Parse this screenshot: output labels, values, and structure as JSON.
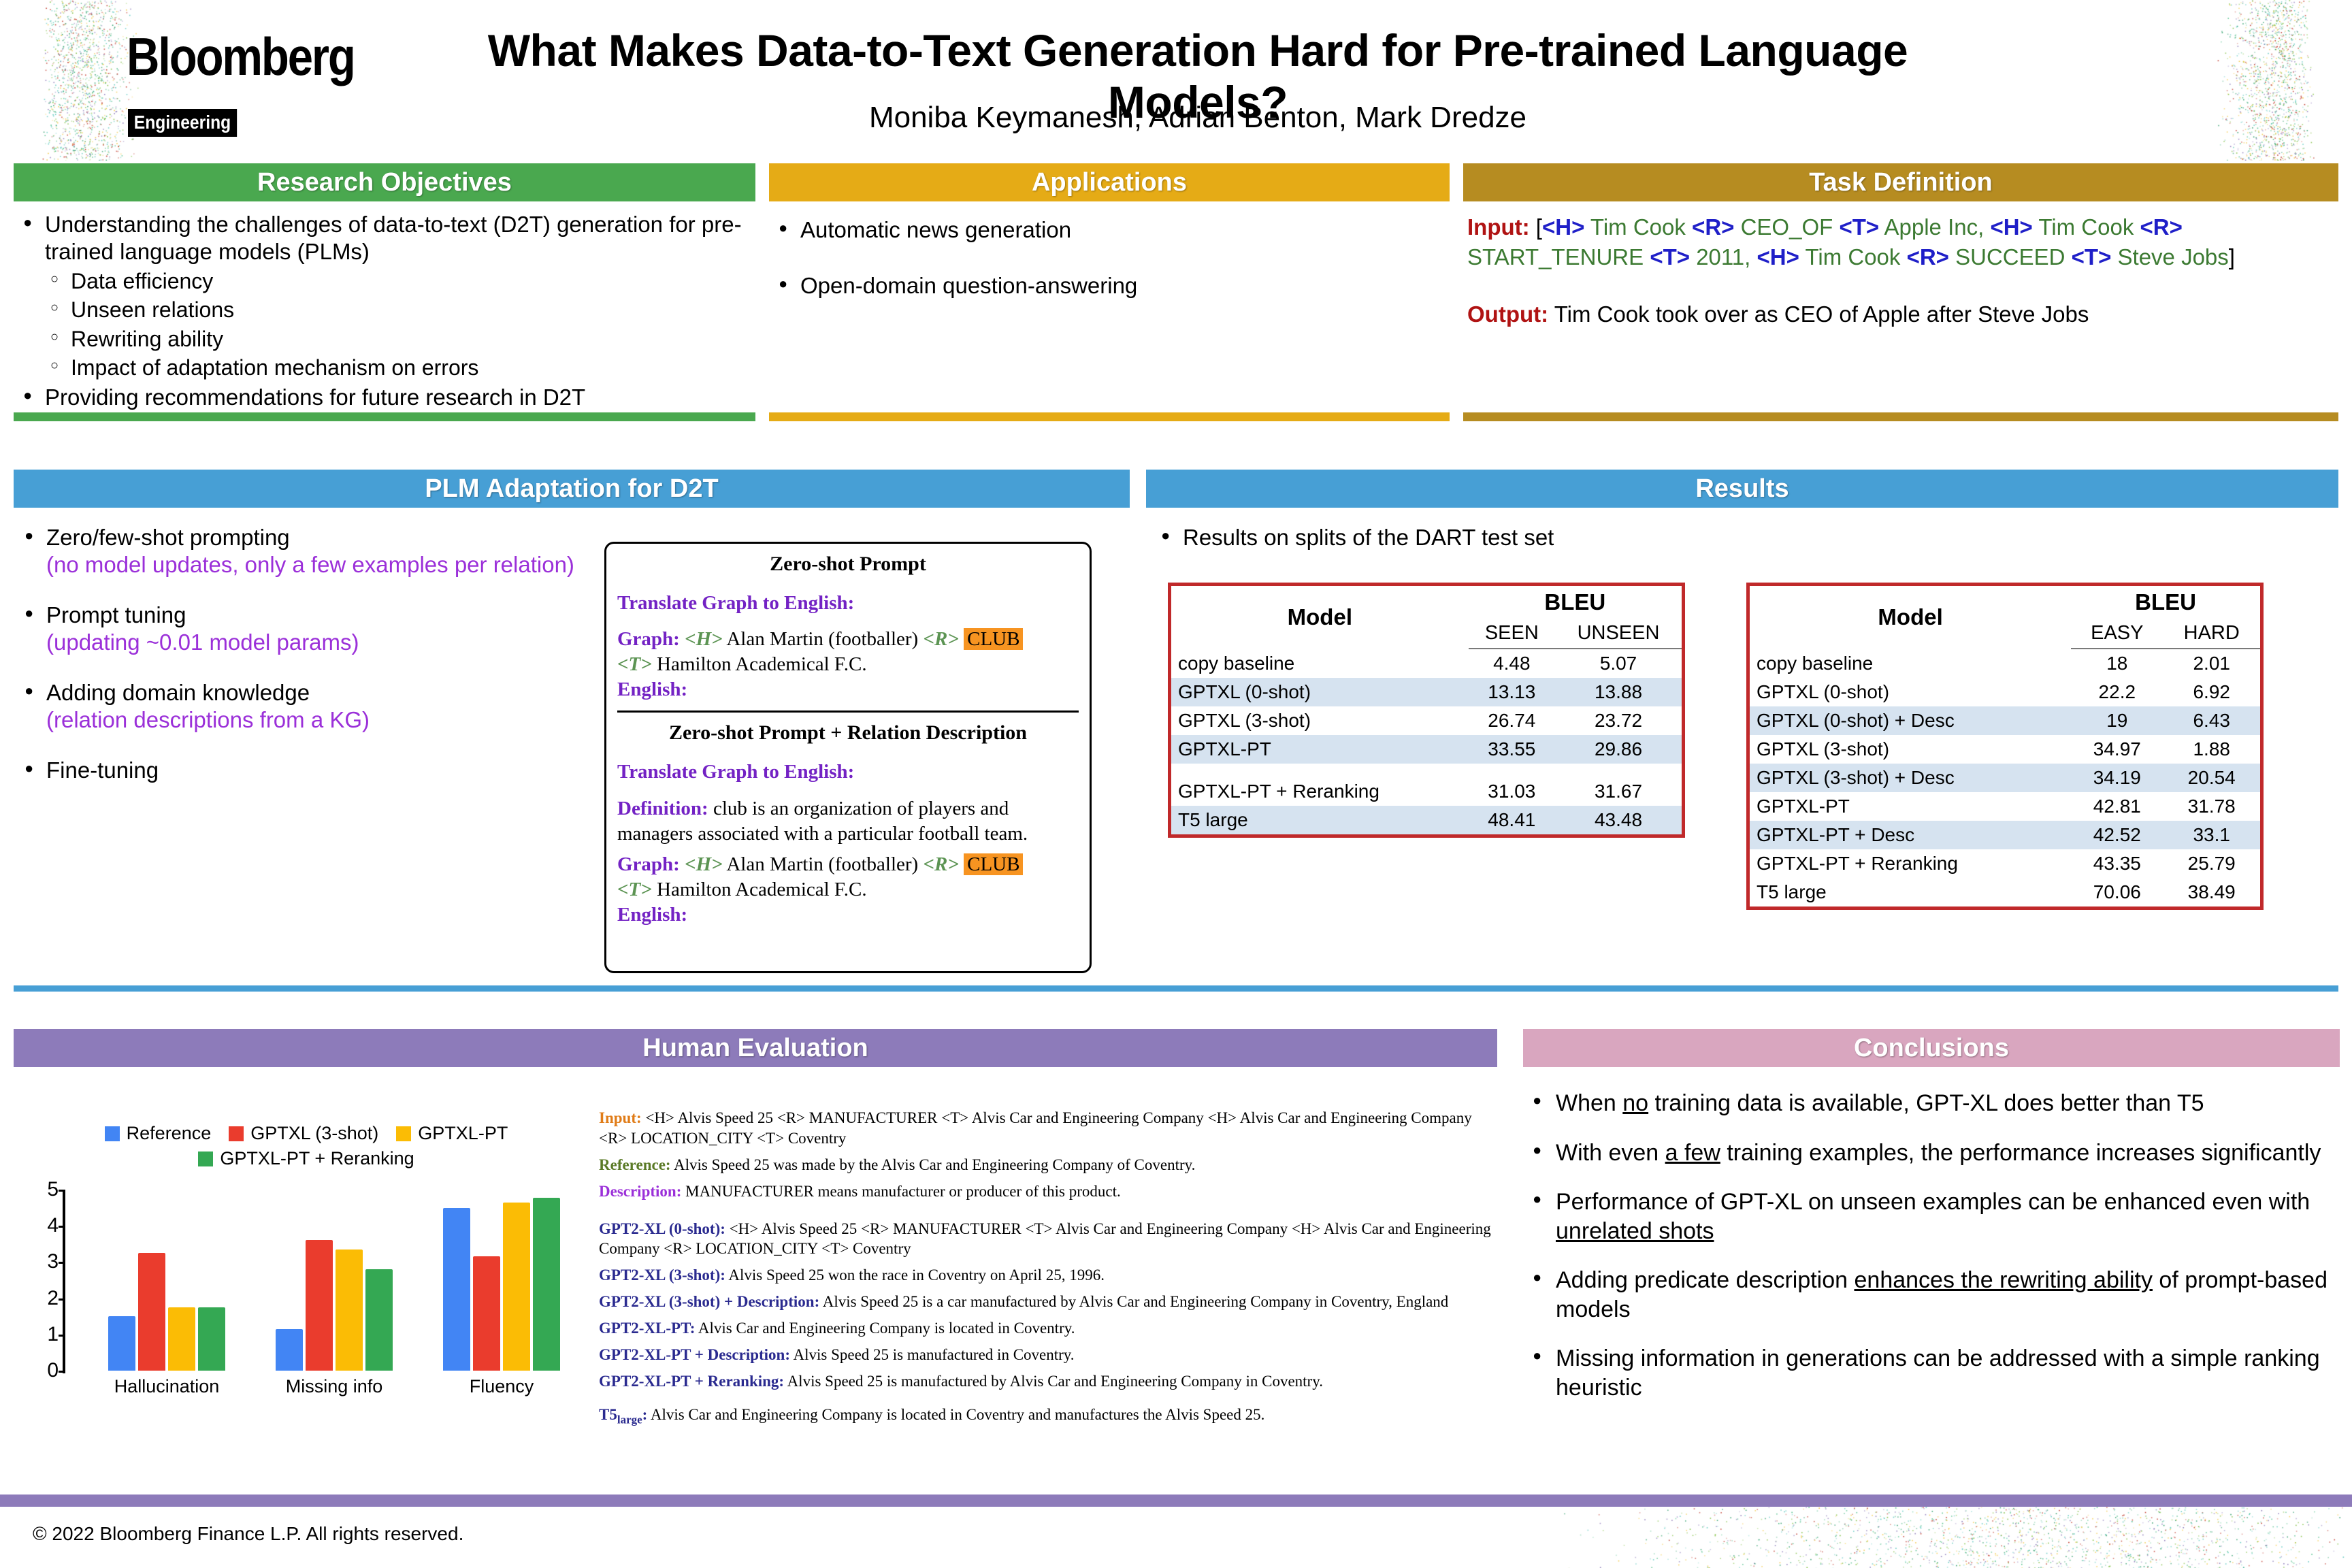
{
  "header": {
    "brand": "Bloomberg",
    "brand_sub": "Engineering",
    "title": "What Makes Data-to-Text Generation Hard for Pre-trained Language Models?",
    "authors": "Moniba Keymanesh, Adrian Benton, Mark Dredze"
  },
  "research_objectives": {
    "heading": "Research Objectives",
    "color": "#4aa84f",
    "bullets": [
      "Understanding the challenges of data-to-text (D2T) generation for pre-trained language models (PLMs)",
      "Providing recommendations for future research in D2T"
    ],
    "sub_bullets": [
      "Data efficiency",
      "Unseen relations",
      "Rewriting ability",
      "Impact of adaptation mechanism on errors"
    ]
  },
  "applications": {
    "heading": "Applications",
    "color": "#e5ab16",
    "bullets": [
      "Automatic news generation",
      "Open-domain question-answering"
    ]
  },
  "task_definition": {
    "heading": "Task Definition",
    "color": "#b68c21",
    "input_label": "Input:",
    "input_parts": [
      {
        "t": "[",
        "c": "black"
      },
      {
        "t": "<H>",
        "c": "blue"
      },
      {
        "t": " Tim Cook ",
        "c": "green"
      },
      {
        "t": "<R>",
        "c": "blue"
      },
      {
        "t": " CEO_OF ",
        "c": "green"
      },
      {
        "t": "<T>",
        "c": "blue"
      },
      {
        "t": " Apple Inc, ",
        "c": "green"
      },
      {
        "t": "<H>",
        "c": "blue"
      },
      {
        "t": " Tim Cook ",
        "c": "green"
      },
      {
        "t": "<R>",
        "c": "blue"
      },
      {
        "t": " START_TENURE ",
        "c": "green"
      },
      {
        "t": "<T>",
        "c": "blue"
      },
      {
        "t": " 2011, ",
        "c": "green"
      },
      {
        "t": "<H>",
        "c": "blue"
      },
      {
        "t": " Tim Cook ",
        "c": "green"
      },
      {
        "t": "<R>",
        "c": "blue"
      },
      {
        "t": " SUCCEED ",
        "c": "green"
      },
      {
        "t": "<T>",
        "c": "blue"
      },
      {
        "t": " Steve Jobs",
        "c": "green"
      },
      {
        "t": "]",
        "c": "black"
      }
    ],
    "output_label": "Output:",
    "output_text": "Tim Cook took over as CEO of Apple after Steve Jobs"
  },
  "plm_adaptation": {
    "heading": "PLM Adaptation for D2T",
    "color": "#479fd5",
    "items": [
      {
        "main": "Zero/few-shot prompting",
        "note": "(no model updates, only a few examples per relation)"
      },
      {
        "main": "Prompt tuning",
        "note": "(updating ~0.01 model params)"
      },
      {
        "main": "Adding domain knowledge",
        "note": "(relation descriptions from a KG)"
      },
      {
        "main": "Fine-tuning",
        "note": ""
      }
    ],
    "prompt_card": {
      "title_1": "Zero-shot Prompt",
      "instruction": "Translate Graph to English:",
      "graph_label": "Graph:",
      "h_tag": "<H>",
      "head": "Alan Martin (footballer)",
      "r_tag": "<R>",
      "relation": "CLUB",
      "t_tag": "<T>",
      "tail": "Hamilton Academical F.C.",
      "english_label": "English:",
      "title_2": "Zero-shot Prompt + Relation Description",
      "definition_label": "Definition:",
      "definition_text": "club is an organization of players and managers associated with a particular football team."
    }
  },
  "results": {
    "heading": "Results",
    "color": "#479fd5",
    "note": "Results on splits of the DART test set",
    "table_seen_unseen": {
      "col_model": "Model",
      "col_metric": "BLEU",
      "subcols": [
        "SEEN",
        "UNSEEN"
      ],
      "rows": [
        {
          "model": "copy baseline",
          "values": [
            "4.48",
            "5.07"
          ],
          "alt": false
        },
        {
          "model": "GPTXL (0-shot)",
          "values": [
            "13.13",
            "13.88"
          ],
          "alt": true
        },
        {
          "model": "GPTXL (3-shot)",
          "values": [
            "26.74",
            "23.72"
          ],
          "alt": false
        },
        {
          "model": "GPTXL-PT",
          "values": [
            "33.55",
            "29.86"
          ],
          "alt": true
        },
        {
          "model": "GPTXL-PT + Reranking",
          "values": [
            "31.03",
            "31.67"
          ],
          "alt": false
        },
        {
          "model": "T5 large",
          "values": [
            "48.41",
            "43.48"
          ],
          "alt": true
        }
      ]
    },
    "table_easy_hard": {
      "col_model": "Model",
      "col_metric": "BLEU",
      "subcols": [
        "EASY",
        "HARD"
      ],
      "rows": [
        {
          "model": "copy baseline",
          "values": [
            "18",
            "2.01"
          ],
          "alt": false
        },
        {
          "model": "GPTXL (0-shot)",
          "values": [
            "22.2",
            "6.92"
          ],
          "alt": false
        },
        {
          "model": "GPTXL (0-shot) + Desc",
          "values": [
            "19",
            "6.43"
          ],
          "alt": true
        },
        {
          "model": "GPTXL (3-shot)",
          "values": [
            "34.97",
            "1.88"
          ],
          "alt": false
        },
        {
          "model": "GPTXL (3-shot) + Desc",
          "values": [
            "34.19",
            "20.54"
          ],
          "alt": true
        },
        {
          "model": "GPTXL-PT",
          "values": [
            "42.81",
            "31.78"
          ],
          "alt": false
        },
        {
          "model": "GPTXL-PT + Desc",
          "values": [
            "42.52",
            "33.1"
          ],
          "alt": true
        },
        {
          "model": "GPTXL-PT + Reranking",
          "values": [
            "43.35",
            "25.79"
          ],
          "alt": false
        },
        {
          "model": "T5 large",
          "values": [
            "70.06",
            "38.49"
          ],
          "alt": false
        }
      ]
    }
  },
  "human_evaluation": {
    "heading": "Human Evaluation",
    "color": "#8d7bba",
    "example": {
      "input_label": "Input:",
      "input_text": "<H> Alvis Speed 25 <R> MANUFACTURER <T> Alvis Car and Engineering Company <H> Alvis Car and Engineering Company <R> LOCATION_CITY <T> Coventry",
      "reference_label": "Reference:",
      "reference_text": "Alvis Speed 25 was made by the Alvis Car and Engineering Company of Coventry.",
      "description_label": "Description:",
      "description_text": "MANUFACTURER means manufacturer or producer of this product.",
      "generations": [
        {
          "label": "GPT2-XL (0-shot):",
          "text": "<H> Alvis Speed 25 <R> MANUFACTURER <T> Alvis Car and Engineering Company <H> Alvis Car and Engineering Company <R> LOCATION_CITY <T> Coventry"
        },
        {
          "label": "GPT2-XL (3-shot):",
          "text": "Alvis Speed 25 won the race in Coventry on April 25, 1996."
        },
        {
          "label": "GPT2-XL (3-shot) + Description:",
          "text": "Alvis Speed 25 is a car manufactured by Alvis Car and Engineering Company in Coventry, England"
        },
        {
          "label": "GPT2-XL-PT:",
          "text": "Alvis Car and Engineering Company is located in Coventry."
        },
        {
          "label": "GPT2-XL-PT + Description:",
          "text": "Alvis Speed 25 is manufactured in Coventry."
        },
        {
          "label": "GPT2-XL-PT + Reranking:",
          "text": "Alvis Speed 25 is manufactured by Alvis Car and Engineering Company in Coventry."
        }
      ],
      "t5_label": "T5",
      "t5_sub": "large",
      "t5_colon": ":",
      "t5_text": "Alvis Car and Engineering Company is located in Coventry and manufactures the Alvis Speed 25."
    }
  },
  "chart_data": {
    "type": "bar",
    "title": "",
    "xlabel": "",
    "ylabel": "",
    "categories": [
      "Hallucination",
      "Missing info",
      "Fluency"
    ],
    "ylim": [
      0,
      5
    ],
    "yticks": [
      0,
      1,
      2,
      3,
      4,
      5
    ],
    "grid": false,
    "legend_position": "top",
    "series": [
      {
        "name": "Reference",
        "color": "#4285f4",
        "values": [
          1.5,
          1.15,
          4.5
        ]
      },
      {
        "name": "GPTXL (3-shot)",
        "color": "#ea3c2d",
        "values": [
          3.25,
          3.6,
          3.15
        ]
      },
      {
        "name": "GPTXL-PT",
        "color": "#fbbc05",
        "values": [
          1.75,
          3.35,
          4.65
        ]
      },
      {
        "name": "GPTXL-PT + Reranking",
        "color": "#34a853",
        "values": [
          1.75,
          2.8,
          4.78
        ]
      }
    ]
  },
  "conclusions": {
    "heading": "Conclusions",
    "color": "#d9a6bf",
    "bullets": [
      {
        "pre": "When ",
        "u": "no",
        "post": " training data is available, GPT-XL does better than T5"
      },
      {
        "pre": "With even ",
        "u": "a few",
        "post": " training examples, the performance increases significantly"
      },
      {
        "pre": "Performance of GPT-XL on unseen examples can be enhanced even with ",
        "u": "unrelated shots",
        "post": ""
      },
      {
        "pre": "Adding predicate description ",
        "u": "enhances the rewriting ability",
        "post": " of prompt-based models"
      },
      {
        "pre": "Missing information in generations can be addressed with a simple ranking heuristic",
        "u": "",
        "post": ""
      }
    ]
  },
  "footer": {
    "copyright": "© 2022 Bloomberg Finance L.P. All rights reserved."
  }
}
